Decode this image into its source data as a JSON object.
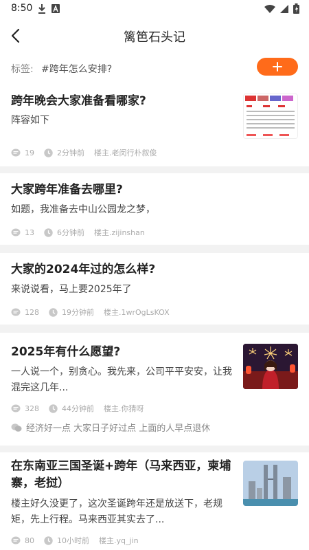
{
  "status_bar": {
    "time": "8:50",
    "left_icons": [
      "download-icon",
      "text-a-icon"
    ],
    "right_icons": [
      "wifi-icon",
      "signal-icon",
      "battery-icon"
    ]
  },
  "header": {
    "back_icon": "chevron-left-icon",
    "title": "篱笆石头记"
  },
  "tag_bar": {
    "label": "标签:",
    "value": "#跨年怎么安排?",
    "add_icon": "plus-icon",
    "accent_color": "#ff6b1a"
  },
  "posts": [
    {
      "title": "跨年晚会大家准备看哪家?",
      "body": "阵容如下",
      "comments": "19",
      "time": "2分钟前",
      "author": "楼主.老闵行朴叙俊",
      "has_thumbnail": true,
      "thumbnail_kind": "schedule-image"
    },
    {
      "title": "大家跨年准备去哪里?",
      "body": "如题，我准备去中山公园龙之梦，",
      "comments": "13",
      "time": "6分钟前",
      "author": "楼主.zijinshan",
      "has_thumbnail": false
    },
    {
      "title": "大家的2024年过的怎么样?",
      "body": "来说说看，马上要2025年了",
      "comments": "128",
      "time": "19分钟前",
      "author": "楼主.1wrOgLsKOX",
      "has_thumbnail": false
    },
    {
      "title": "2025年有什么愿望?",
      "body_lines": [
        "一人说一个，别贪心。我先来，公司平平安安，让我",
        "混完这几年..."
      ],
      "comments": "328",
      "time": "44分钟前",
      "author": "楼主.你猜呀",
      "reply": "经济好一点 大家日子好过点 上面的人早点退休",
      "has_thumbnail": true,
      "thumbnail_kind": "fireworks-girl-image"
    },
    {
      "title_lines": [
        "在东南亚三国圣诞+跨年（马来西亚，柬埔",
        "寨，老挝）"
      ],
      "body_lines": [
        "楼主好久没更了，这次圣诞跨年还是放送下，老规",
        "矩，先上行程。马来西亚其实去了..."
      ],
      "comments": "80",
      "time": "10小时前",
      "author": "楼主.yq_jin",
      "has_thumbnail": true,
      "thumbnail_kind": "city-towers-image"
    }
  ]
}
